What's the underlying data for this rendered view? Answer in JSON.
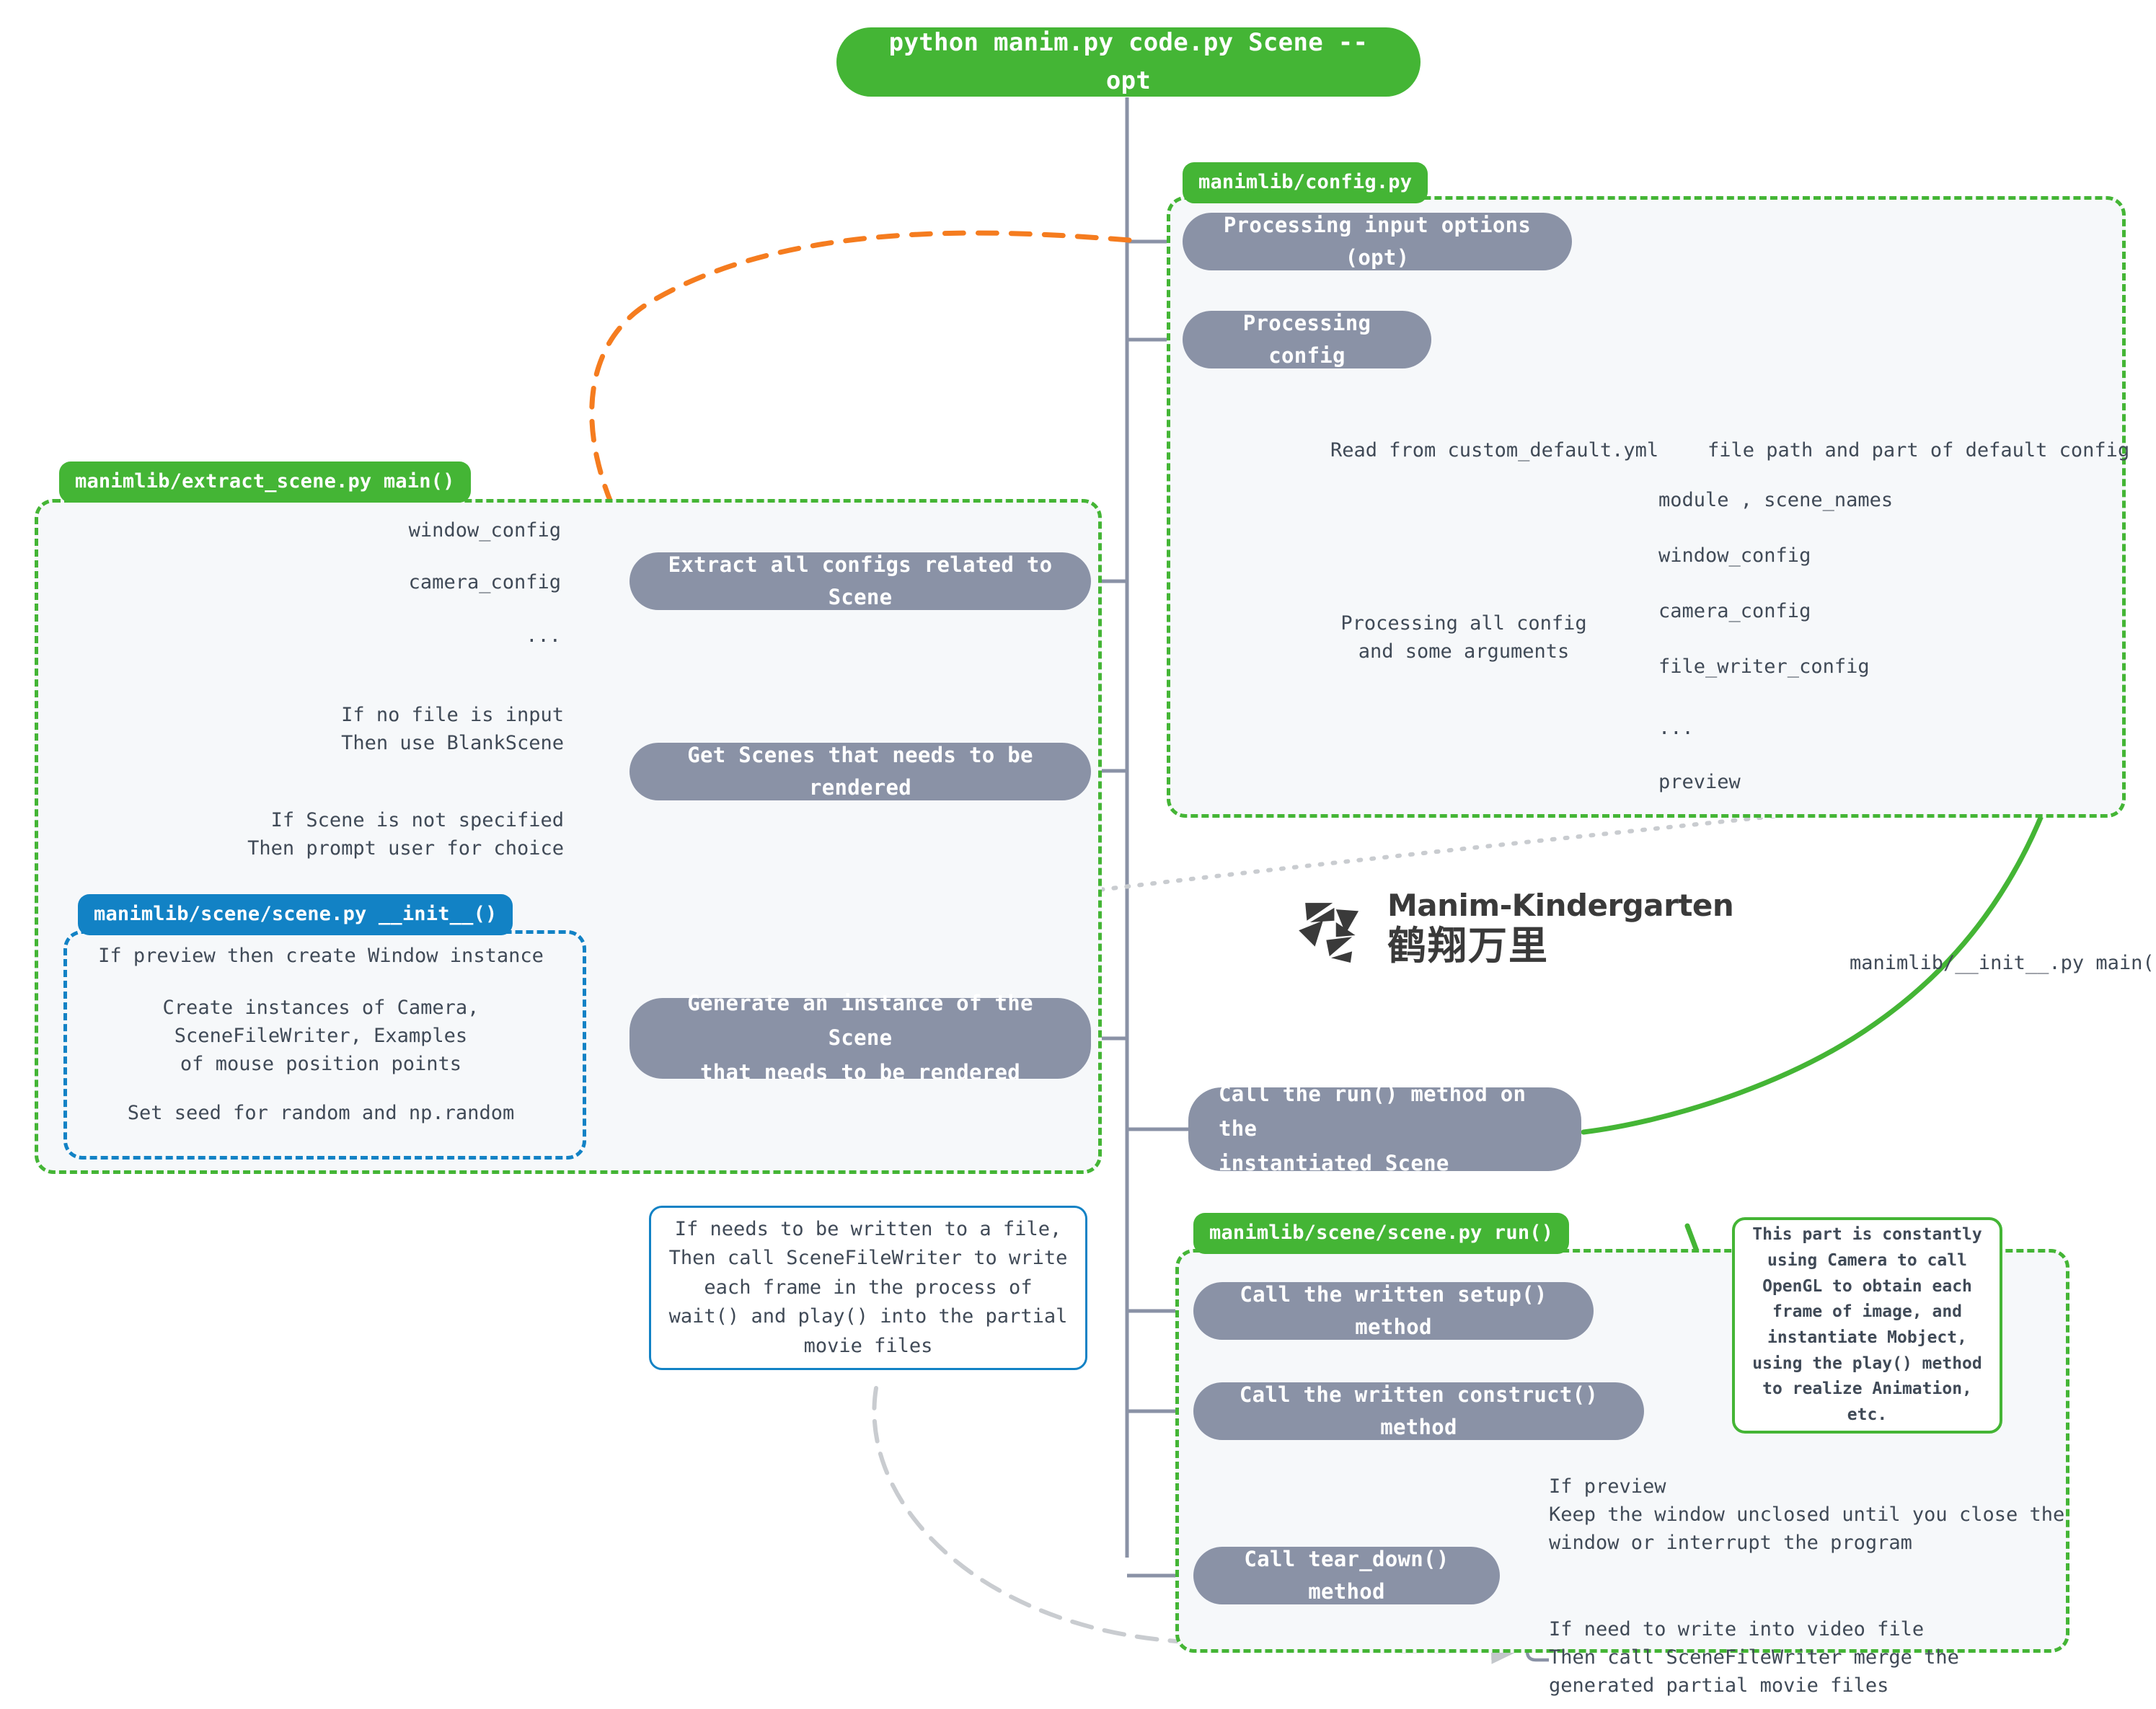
{
  "command": {
    "label": "python manim.py code.py Scene --opt"
  },
  "colors": {
    "green": "#44b535",
    "blue": "#1282c5",
    "gray_pill": "#8a92a6",
    "orange_arrow": "#f57c1f",
    "teal_arrow": "#0a8cb0",
    "panel_bg": "#f6f8fa",
    "text": "#404a57"
  },
  "panels": {
    "config": {
      "tag": "manimlib/config.py",
      "steps": [
        {
          "label": "Processing input options (opt)"
        },
        {
          "label": "Processing config"
        }
      ],
      "branches": {
        "read_yml": "Read from custom_default.yml",
        "read_yml_detail": "file path and part of default config",
        "processing_all": "Processing all config\nand some arguments",
        "config_items": [
          "module , scene_names",
          "window_config",
          "camera_config",
          "file_writer_config",
          "...",
          "preview"
        ]
      }
    },
    "extract_scene": {
      "tag": "manimlib/extract_scene.py main()",
      "extract_configs_items": [
        "window_config",
        "camera_config",
        "..."
      ],
      "steps": [
        {
          "label": "Extract all configs related to Scene"
        },
        {
          "label": "Get Scenes that needs to be rendered"
        },
        {
          "label": "Generate an instance of the Scene\nthat needs to be rendered"
        }
      ],
      "get_scenes_notes": [
        "If no file is input\nThen use BlankScene",
        "If Scene is not specified\nThen prompt user for choice"
      ]
    },
    "scene_init": {
      "tag": "manimlib/scene/scene.py __init__()",
      "items": [
        "If preview then create Window instance",
        "Create instances of Camera,\nSceneFileWriter, Examples\nof mouse position points",
        "Set seed for random and np.random"
      ]
    },
    "scene_run": {
      "tag": "manimlib/scene/scene.py run()",
      "steps": [
        {
          "label": "Call the written setup() method"
        },
        {
          "label": "Call the written construct() method"
        },
        {
          "label": "Call tear_down() method"
        }
      ],
      "tear_down_notes": [
        "If preview\nKeep the window unclosed until you close the\nwindow or interrupt the program",
        "If need to write into video file\nThen call SceneFileWriter merge the\ngenerated partial movie files"
      ]
    }
  },
  "run_method_pill": {
    "label": "Call the run() method on the\ninstantiated Scene"
  },
  "callouts": {
    "file_writer": "If needs to be written to a file,\nThen call SceneFileWriter to write\neach frame in the process of\nwait() and play() into the partial\nmovie files",
    "constantly": "This part is constantly\nusing Camera to call\nOpenGL to obtain each\nframe of image, and\ninstantiate Mobject,\nusing the play() method\nto realize Animation,\netc."
  },
  "side_label": {
    "init_main": "manimlib/__init__.py main()"
  },
  "logo": {
    "english": "Manim-Kindergarten",
    "chinese": "鹤翔万里"
  }
}
